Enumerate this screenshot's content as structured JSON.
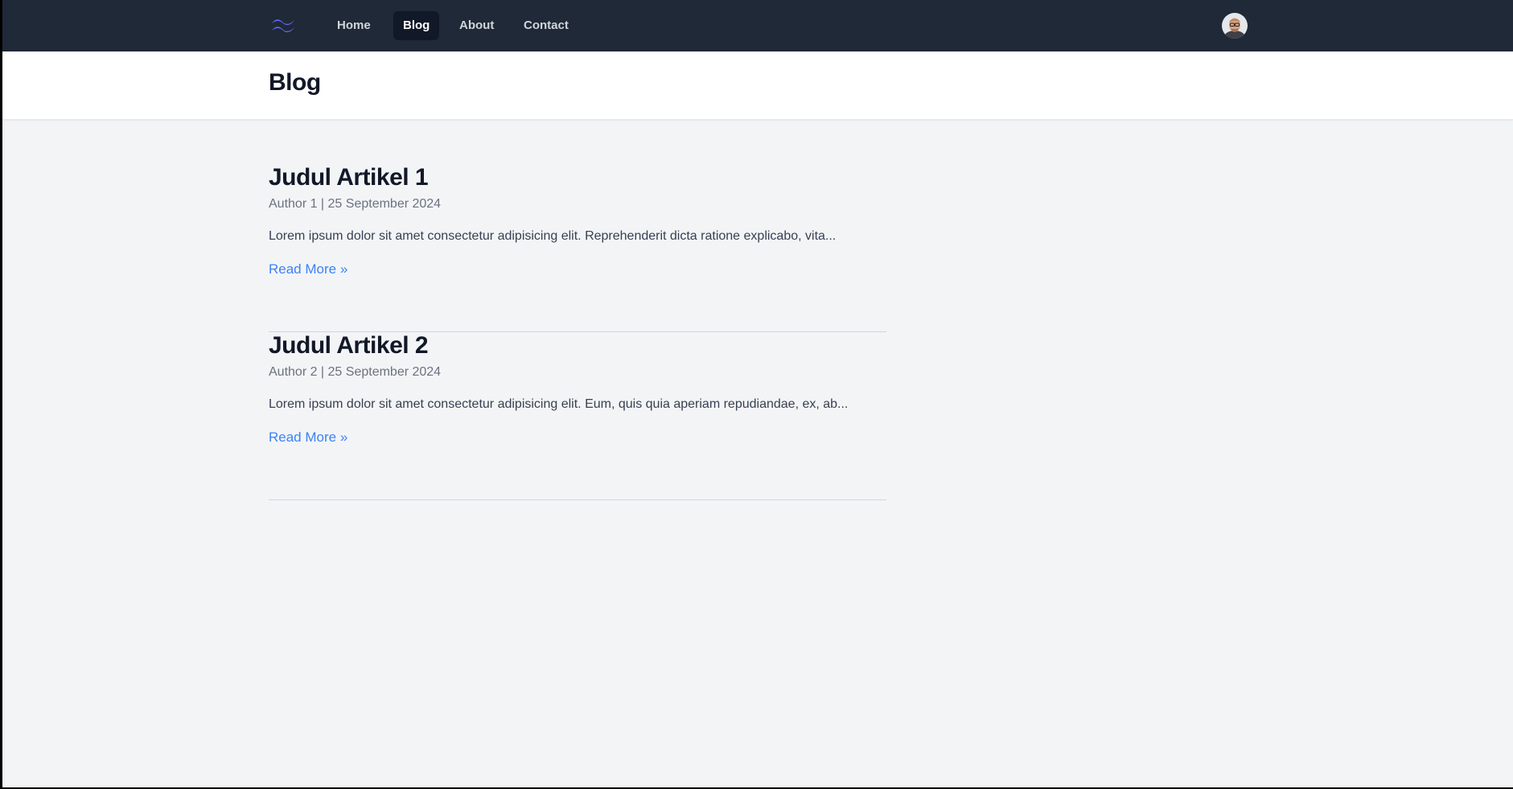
{
  "nav": {
    "logo_icon": "tailwind-wave-icon",
    "links": [
      {
        "label": "Home",
        "active": false
      },
      {
        "label": "Blog",
        "active": true
      },
      {
        "label": "About",
        "active": false
      },
      {
        "label": "Contact",
        "active": false
      }
    ],
    "avatar_icon": "user-avatar-icon"
  },
  "page": {
    "title": "Blog"
  },
  "articles": [
    {
      "title": "Judul Artikel 1",
      "meta": "Author 1 | 25 September 2024",
      "excerpt": "Lorem ipsum dolor sit amet consectetur adipisicing elit. Reprehenderit dicta ratione explicabo, vita...",
      "read_more": "Read More »"
    },
    {
      "title": "Judul Artikel 2",
      "meta": "Author 2 | 25 September 2024",
      "excerpt": "Lorem ipsum dolor sit amet consectetur adipisicing elit. Eum, quis quia aperiam repudiandae, ex, ab...",
      "read_more": "Read More »"
    }
  ],
  "colors": {
    "navbar_bg": "#1f2937",
    "active_link_bg": "#111827",
    "link_blue": "#3b82f6",
    "logo_indigo": "#6366f1",
    "page_bg": "#f3f4f6"
  }
}
